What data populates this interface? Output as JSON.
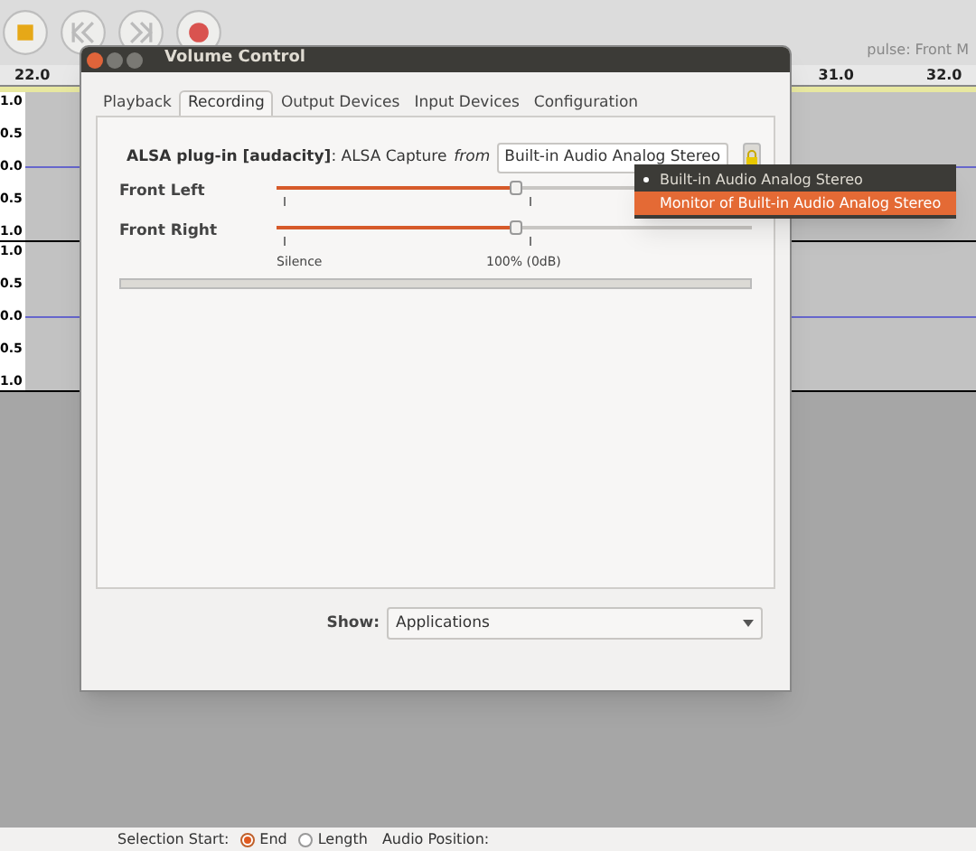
{
  "toolbar": {
    "buttons": [
      {
        "kind": "stop"
      },
      {
        "kind": "skip-start"
      },
      {
        "kind": "skip-end"
      },
      {
        "kind": "record"
      }
    ],
    "device_text": "pulse: Front M"
  },
  "ruler": {
    "labels": [
      "22.0",
      "31.0",
      "32.0"
    ]
  },
  "tracks": [
    {
      "axis": [
        "1.0",
        "0.5",
        "0.0",
        "0.5",
        "1.0"
      ]
    },
    {
      "axis": [
        "1.0",
        "0.5",
        "0.0",
        "0.5",
        "1.0"
      ]
    }
  ],
  "status_bar": {
    "selection_label": "Selection Start:",
    "options": [
      {
        "label": "End",
        "selected": true
      },
      {
        "label": "Length",
        "selected": false
      }
    ],
    "position_label": "Audio Position:"
  },
  "dialog": {
    "title": "Volume Control",
    "tabs": [
      {
        "label": "Playback",
        "selected": false
      },
      {
        "label": "Recording",
        "selected": true
      },
      {
        "label": "Output Devices",
        "selected": false
      },
      {
        "label": "Input Devices",
        "selected": false
      },
      {
        "label": "Configuration",
        "selected": false
      }
    ],
    "stream": {
      "app": "ALSA plug-in [audacity]",
      "name": ": ALSA Capture",
      "from": "from",
      "device": "Built-in Audio Analog Stereo",
      "channels": [
        {
          "name": "Front Left",
          "level": 0.5
        },
        {
          "name": "Front Right",
          "level": 0.5
        }
      ],
      "scale": [
        "Silence",
        "100% (0dB)"
      ]
    },
    "show_label": "Show:",
    "show_value": "Applications"
  },
  "menu": {
    "items": [
      {
        "label": "Built-in Audio Analog Stereo",
        "selected": true,
        "hovered": false
      },
      {
        "label": "Monitor of Built-in Audio Analog Stereo",
        "selected": false,
        "hovered": true
      }
    ]
  }
}
